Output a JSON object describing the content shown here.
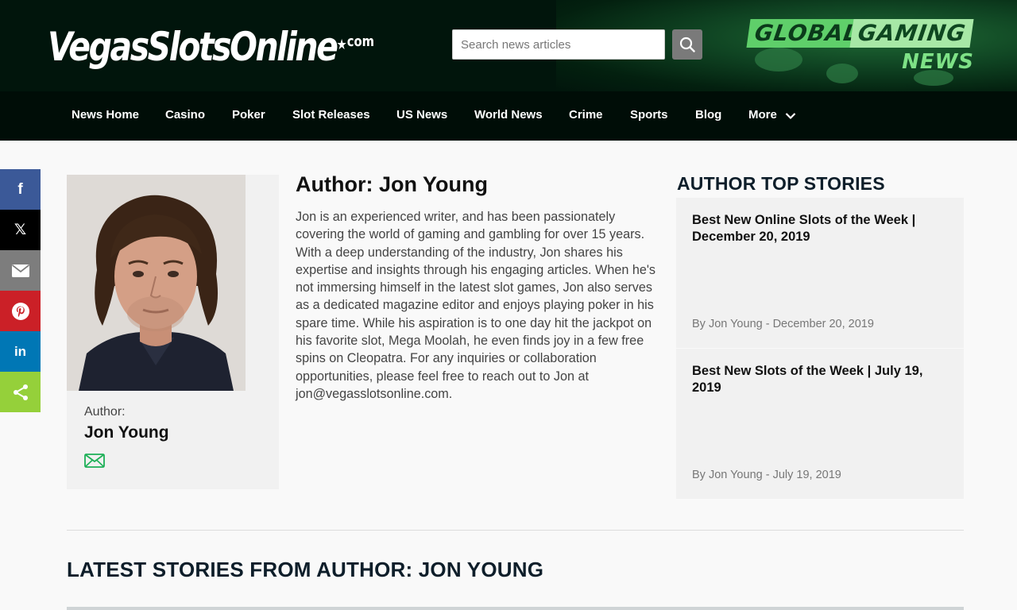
{
  "header": {
    "logo_main": "VegasSlotsOnline",
    "logo_star": "★",
    "logo_suffix": "com",
    "search": {
      "placeholder": "Search news articles",
      "value": ""
    },
    "brand": {
      "line1a": "GLOBAL",
      "line1b": "GAMING",
      "line2": "NEWS"
    }
  },
  "nav": {
    "items": [
      "News Home",
      "Casino",
      "Poker",
      "Slot Releases",
      "US News",
      "World News",
      "Crime",
      "Sports",
      "Blog",
      "More"
    ]
  },
  "share": {
    "facebook": "f",
    "x": "𝕏",
    "linkedin": "in",
    "colors": {
      "facebook": "#3b5998",
      "x": "#000000",
      "email": "#7d7d7d",
      "pinterest": "#cb2027",
      "linkedin": "#0077b5",
      "share": "#95d03a"
    }
  },
  "author": {
    "card_label": "Author:",
    "name": "Jon Young",
    "title": "Author: Jon Young",
    "bio": "Jon is an experienced writer, and has been passionately covering the world of gaming and gambling for over 15 years. With a deep understanding of the industry, Jon shares his expertise and insights through his engaging articles. When he's not immersing himself in the latest slot games, Jon also serves as a dedicated magazine editor and enjoys playing poker in his spare time. While his aspiration is to one day hit the jackpot on his favorite slot, Mega Moolah, he even finds joy in a few free spins on Cleopatra. For any inquiries or collaboration opportunities, please feel free to reach out to Jon at jon@vegasslotsonline.com."
  },
  "top_stories": {
    "heading": "AUTHOR TOP STORIES",
    "items": [
      {
        "title": "Best New Online Slots of the Week | December 20, 2019",
        "meta": "By Jon Young - December 20, 2019"
      },
      {
        "title": "Best New Slots of the Week | July 19, 2019",
        "meta": "By Jon Young - July 19, 2019"
      }
    ]
  },
  "latest": {
    "heading": "LATEST STORIES FROM AUTHOR: JON YOUNG"
  },
  "colors": {
    "accent_green": "#1db057",
    "header_bg": "#01150c"
  }
}
